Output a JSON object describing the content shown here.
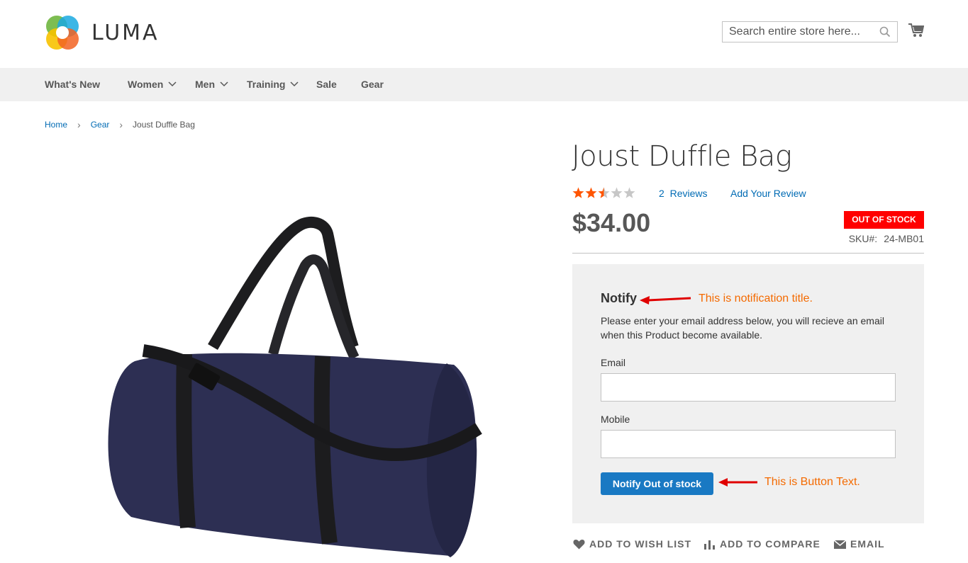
{
  "brand": {
    "name": "LUMA"
  },
  "search": {
    "placeholder": "Search entire store here..."
  },
  "nav": [
    "What's New",
    "Women",
    "Men",
    "Training",
    "Sale",
    "Gear"
  ],
  "breadcrumb": {
    "home": "Home",
    "gear": "Gear",
    "current": "Joust Duffle Bag"
  },
  "product": {
    "title": "Joust Duffle Bag",
    "rating_stars": 2.5,
    "rating_max": 5,
    "reviews_count": "2",
    "reviews_label": "Reviews",
    "add_review": "Add Your Review",
    "price": "$34.00",
    "stock_status": "OUT OF STOCK",
    "sku_label": "SKU#:",
    "sku": "24-MB01"
  },
  "notify": {
    "title": "Notify",
    "description": "Please enter your email address below, you will recieve an email when this Product become available.",
    "email_label": "Email",
    "email_value": "",
    "mobile_label": "Mobile",
    "mobile_value": "",
    "button": "Notify Out of stock"
  },
  "annotations": {
    "title_note": "This is notification title.",
    "button_note": "This is Button Text."
  },
  "actions": {
    "wishlist": "Add to Wish List",
    "compare": "Add to Compare",
    "email": "Email"
  },
  "colors": {
    "link": "#006bb4",
    "button": "#1979c3",
    "badge": "#ff0000",
    "annotation": "#f46a00",
    "star": "#ff5501"
  }
}
